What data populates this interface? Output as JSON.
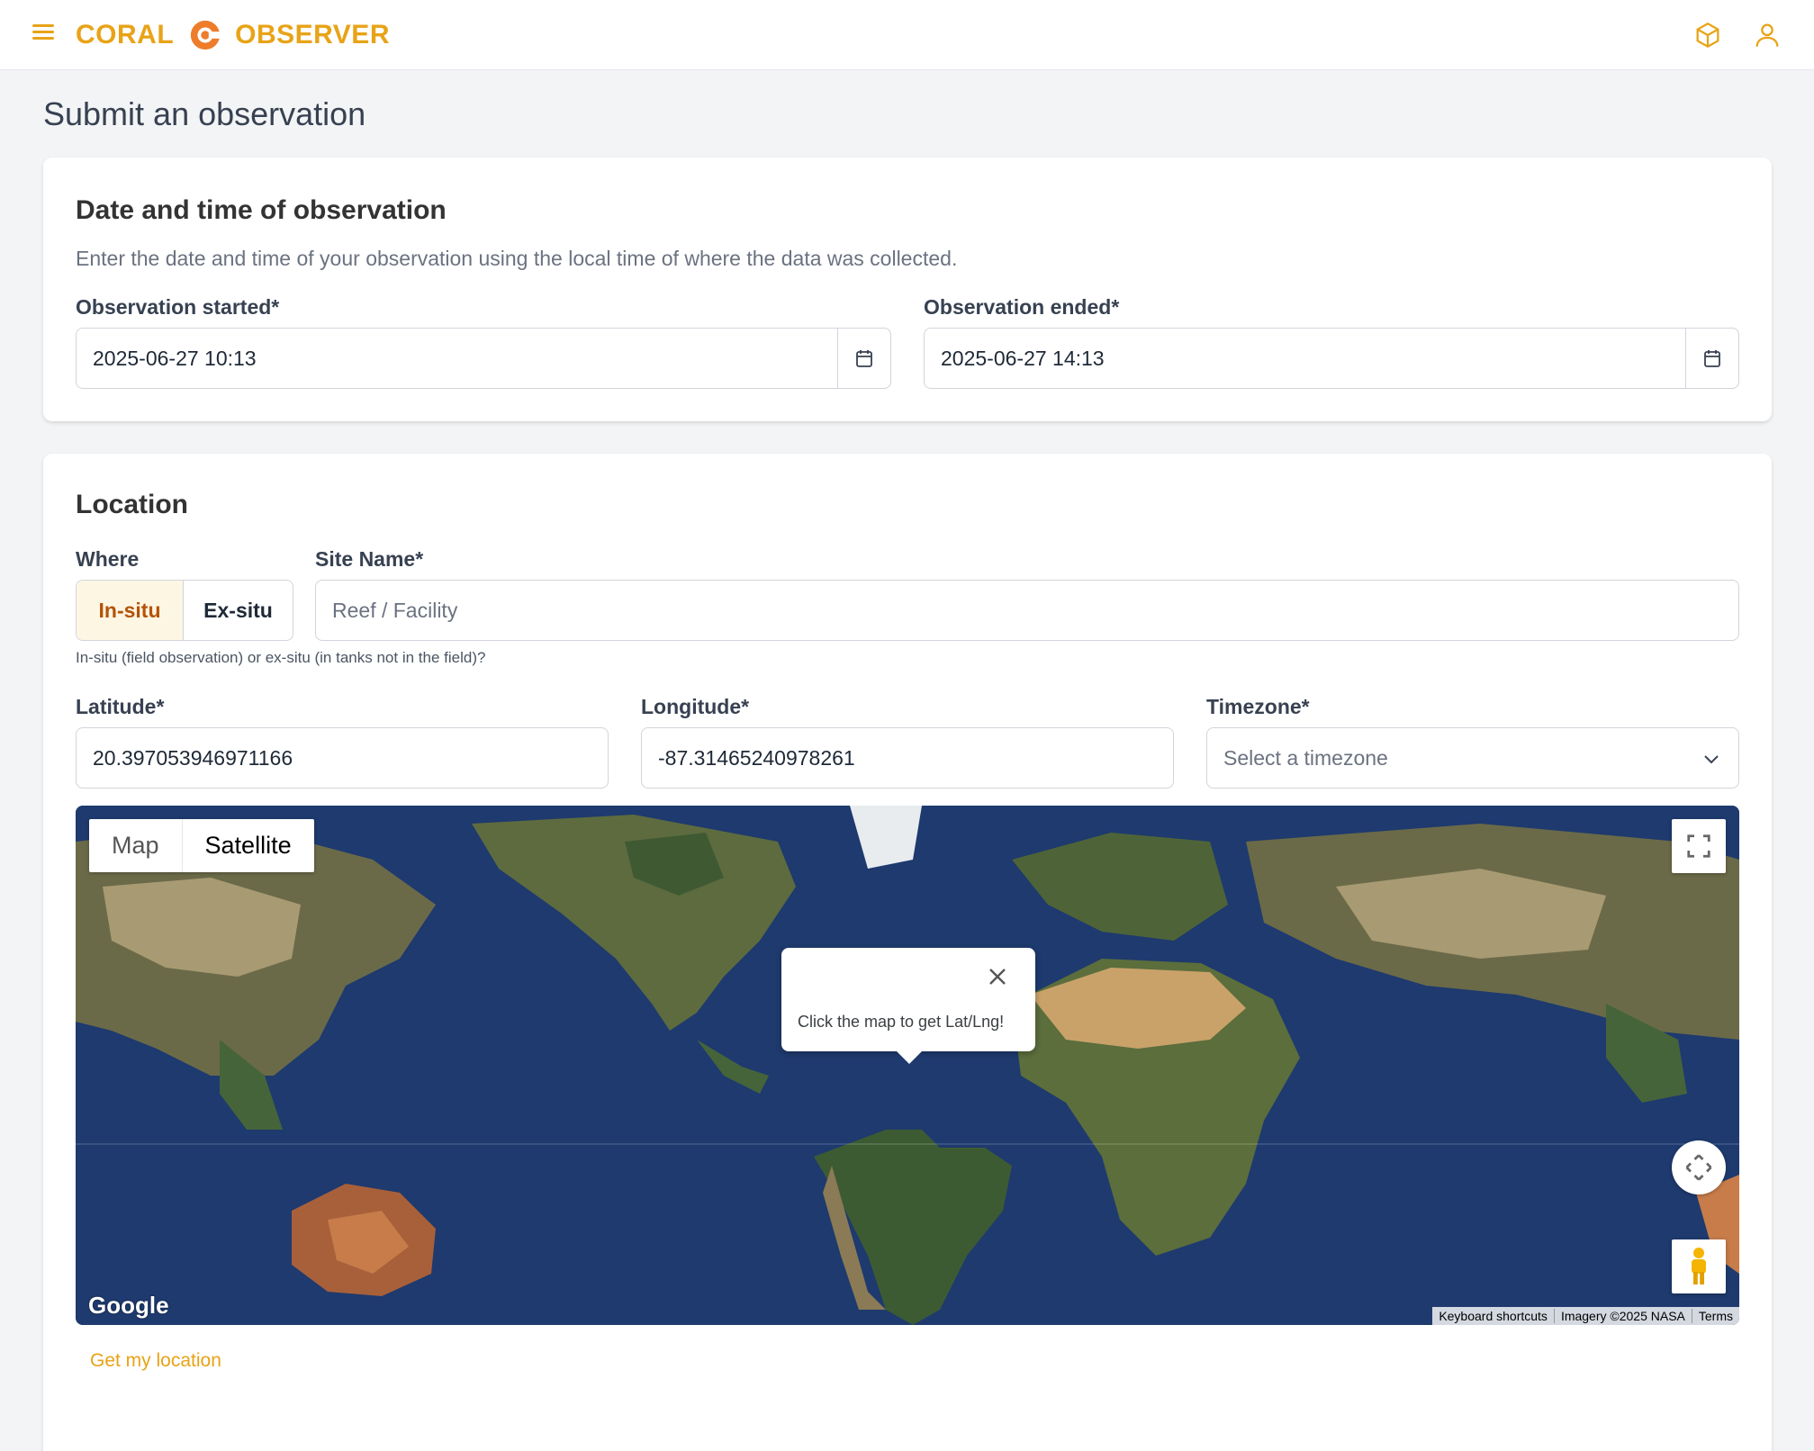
{
  "header": {
    "brand_left": "CORAL",
    "brand_right": "OBSERVER",
    "accent_color": "#e8a317",
    "icons": [
      "menu-icon",
      "coral-logo",
      "cube-icon",
      "user-icon"
    ]
  },
  "page": {
    "title": "Submit an observation"
  },
  "datetime": {
    "title": "Date and time of observation",
    "description": "Enter the date and time of your observation using the local time of where the data was collected.",
    "started_label": "Observation started*",
    "started_value": "2025-06-27 10:13",
    "ended_label": "Observation ended*",
    "ended_value": "2025-06-27 14:13"
  },
  "location": {
    "title": "Location",
    "where_label": "Where",
    "where_options": [
      "In-situ",
      "Ex-situ"
    ],
    "where_selected": "In-situ",
    "where_helper": "In-situ (field observation) or ex-situ (in tanks not in the field)?",
    "site_label": "Site Name*",
    "site_placeholder": "Reef / Facility",
    "lat_label": "Latitude*",
    "lat_value": "20.397053946971166",
    "lng_label": "Longitude*",
    "lng_value": "-87.31465240978261",
    "tz_label": "Timezone*",
    "tz_placeholder": "Select a timezone",
    "get_location": "Get my location"
  },
  "map": {
    "type_options": [
      "Map",
      "Satellite"
    ],
    "type_selected": "Satellite",
    "infowindow_text": "Click the map to get Lat/Lng!",
    "logo": "Google",
    "attribution": [
      "Keyboard shortcuts",
      "Imagery ©2025 NASA",
      "Terms"
    ]
  }
}
